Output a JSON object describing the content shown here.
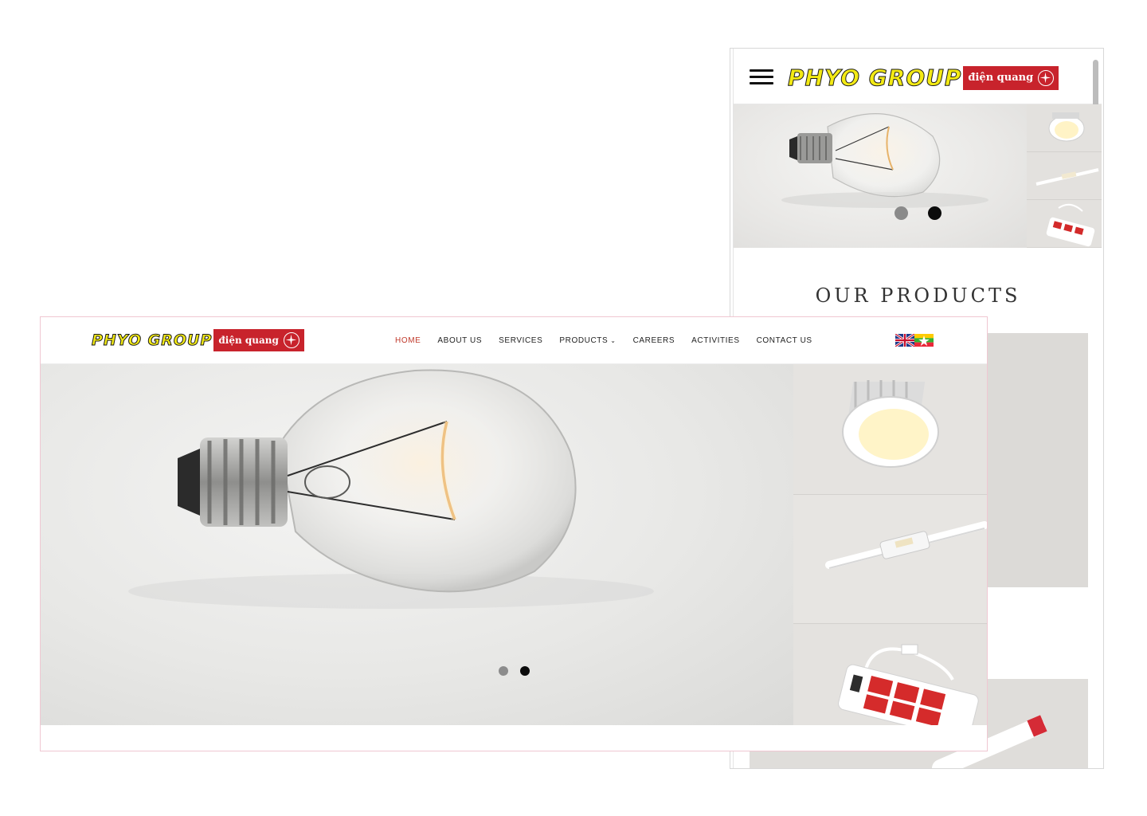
{
  "brand": {
    "name_part1": "PHYO GROUP",
    "name_part2": "điện quang",
    "colors": {
      "yellow": "#f3ea14",
      "red": "#c8232c",
      "nav_active": "#c0392b"
    }
  },
  "nav": {
    "items": [
      {
        "label": "HOME",
        "active": true
      },
      {
        "label": "ABOUT US"
      },
      {
        "label": "SERVICES"
      },
      {
        "label": "PRODUCTS",
        "has_dropdown": true
      },
      {
        "label": "CAREERS"
      },
      {
        "label": "ACTIVITIES"
      },
      {
        "label": "CONTACT US"
      }
    ],
    "dropdown_icon": "chevron-down-icon",
    "languages": [
      "english-flag-icon",
      "myanmar-flag-icon"
    ]
  },
  "hero": {
    "slides_total": 2,
    "active_slide": 2,
    "main_image": "light-bulb",
    "thumbnails": [
      "downlight",
      "led-tube-fixture",
      "power-strip"
    ]
  },
  "mobile": {
    "menu_icon": "hamburger-icon",
    "section_title": "OUR PRODUCTS"
  }
}
